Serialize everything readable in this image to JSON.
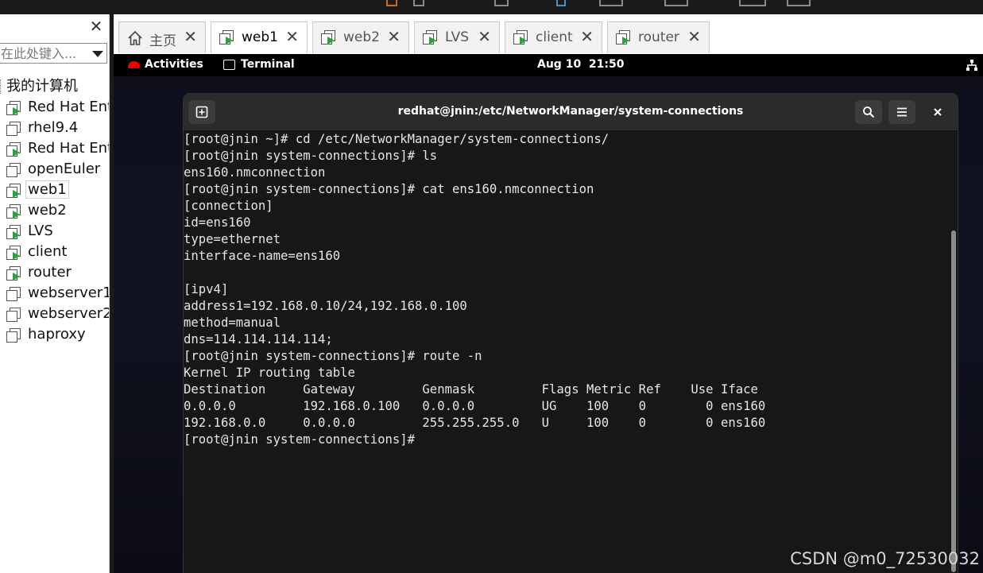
{
  "sidebar": {
    "close_glyph": "✕",
    "search_placeholder": "在此处键入...",
    "root_label": "我的计算机",
    "items": [
      {
        "label": "Red Hat Ent",
        "running": true
      },
      {
        "label": "rhel9.4",
        "running": false
      },
      {
        "label": "Red Hat Ent",
        "running": true
      },
      {
        "label": "openEuler",
        "running": false
      },
      {
        "label": "web1",
        "running": true,
        "selected": true
      },
      {
        "label": "web2",
        "running": true
      },
      {
        "label": "LVS",
        "running": true
      },
      {
        "label": "client",
        "running": true
      },
      {
        "label": "router",
        "running": true
      },
      {
        "label": "webserver1",
        "running": false
      },
      {
        "label": "webserver2",
        "running": false
      },
      {
        "label": "haproxy",
        "running": false
      }
    ]
  },
  "tabs": [
    {
      "label": "主页",
      "icon": "home-icon",
      "active": false
    },
    {
      "label": "web1",
      "icon": "vm-running-icon",
      "active": true
    },
    {
      "label": "web2",
      "icon": "vm-running-icon",
      "active": false
    },
    {
      "label": "LVS",
      "icon": "vm-running-icon",
      "active": false
    },
    {
      "label": "client",
      "icon": "vm-running-icon",
      "active": false
    },
    {
      "label": "router",
      "icon": "vm-running-icon",
      "active": false
    }
  ],
  "tab_close_glyph": "✕",
  "gnome": {
    "activities": "Activities",
    "app": "Terminal",
    "clock": "Aug 10  21:50"
  },
  "terminal": {
    "title": "redhat@jnin:/etc/NetworkManager/system-connections",
    "new_tab_glyph": "⊞",
    "search_glyph": "🔍",
    "menu_glyph": "≡",
    "close_glyph": "✕",
    "lines": [
      "[root@jnin ~]# cd /etc/NetworkManager/system-connections/",
      "[root@jnin system-connections]# ls",
      "ens160.nmconnection",
      "[root@jnin system-connections]# cat ens160.nmconnection",
      "[connection]",
      "id=ens160",
      "type=ethernet",
      "interface-name=ens160",
      "",
      "[ipv4]",
      "address1=192.168.0.10/24,192.168.0.100",
      "method=manual",
      "dns=114.114.114.114;",
      "[root@jnin system-connections]# route -n",
      "Kernel IP routing table",
      "Destination     Gateway         Genmask         Flags Metric Ref    Use Iface",
      "0.0.0.0         192.168.0.100   0.0.0.0         UG    100    0        0 ens160",
      "192.168.0.0     0.0.0.0         255.255.255.0   U     100    0        0 ens160",
      "[root@jnin system-connections]# "
    ]
  },
  "watermark": "CSDN @m0_72530032"
}
